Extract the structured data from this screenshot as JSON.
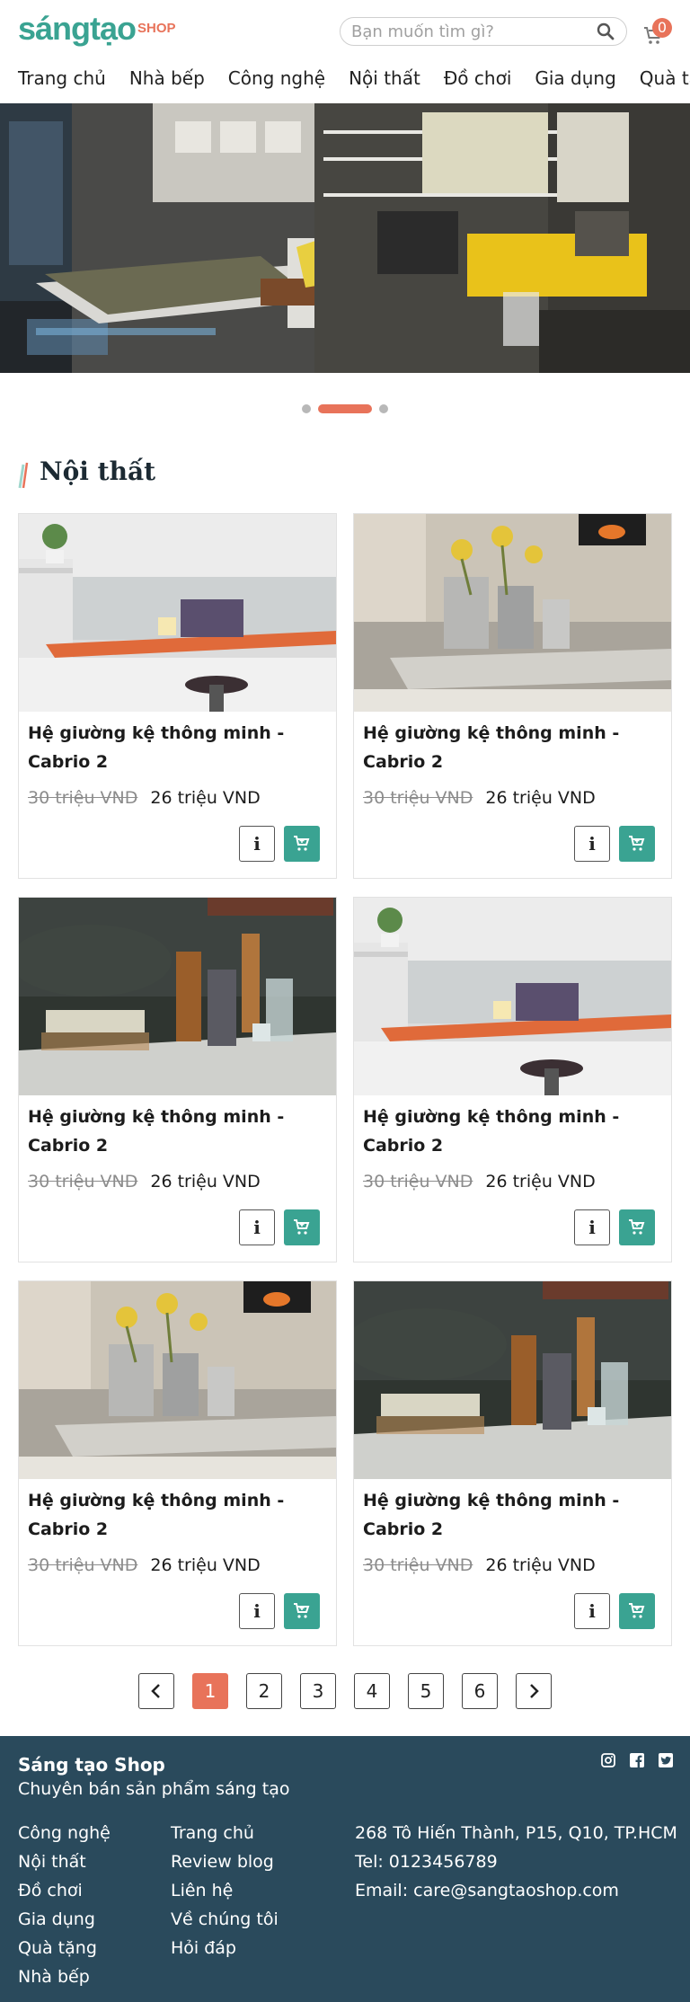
{
  "header": {
    "logo_main": "sángtạo",
    "logo_shop": "SHOP",
    "search_placeholder": "Bạn muốn tìm gì?",
    "cart_count": "0",
    "nav": [
      "Trang chủ",
      "Nhà bếp",
      "Công nghệ",
      "Nội thất",
      "Đồ chơi",
      "Gia dụng",
      "Quà tặng"
    ]
  },
  "section": {
    "title": "Nội thất"
  },
  "products": [
    {
      "name": "Hệ giường kệ thông minh - Cabrio 2",
      "old_price": "30 triệu VND",
      "price": "26 triệu VND",
      "image": "desk"
    },
    {
      "name": "Hệ giường kệ thông minh - Cabrio 2",
      "old_price": "30 triệu VND",
      "price": "26 triệu VND",
      "image": "flowers"
    },
    {
      "name": "Hệ giường kệ thông minh - Cabrio 2",
      "old_price": "30 triệu VND",
      "price": "26 triệu VND",
      "image": "bottles"
    },
    {
      "name": "Hệ giường kệ thông minh - Cabrio 2",
      "old_price": "30 triệu VND",
      "price": "26 triệu VND",
      "image": "desk"
    },
    {
      "name": "Hệ giường kệ thông minh - Cabrio 2",
      "old_price": "30 triệu VND",
      "price": "26 triệu VND",
      "image": "flowers"
    },
    {
      "name": "Hệ giường kệ thông minh - Cabrio 2",
      "old_price": "30 triệu VND",
      "price": "26 triệu VND",
      "image": "bottles"
    }
  ],
  "product_actions": {
    "info_label": "i"
  },
  "pagination": {
    "pages": [
      "1",
      "2",
      "3",
      "4",
      "5",
      "6"
    ],
    "active": "1"
  },
  "footer": {
    "title": "Sáng tạo Shop",
    "subtitle": "Chuyên bán sản phẩm sáng tạo",
    "col1": [
      "Công nghệ",
      "Nội thất",
      "Đồ chơi",
      "Gia dụng",
      "Quà tặng",
      "Nhà bếp"
    ],
    "col2": [
      "Trang chủ",
      "Review blog",
      "Liên hệ",
      "Về chúng tôi",
      "Hỏi đáp"
    ],
    "address": "268 Tô Hiến Thành, P15, Q10, TP.HCM",
    "tel": "Tel: 0123456789",
    "email": "Email: care@sangtaoshop.com",
    "social": [
      "instagram-icon",
      "facebook-icon",
      "twitter-icon"
    ]
  },
  "colors": {
    "brand": "#3aa392",
    "accent": "#e8735a",
    "footer_bg": "#2a4a5c"
  }
}
